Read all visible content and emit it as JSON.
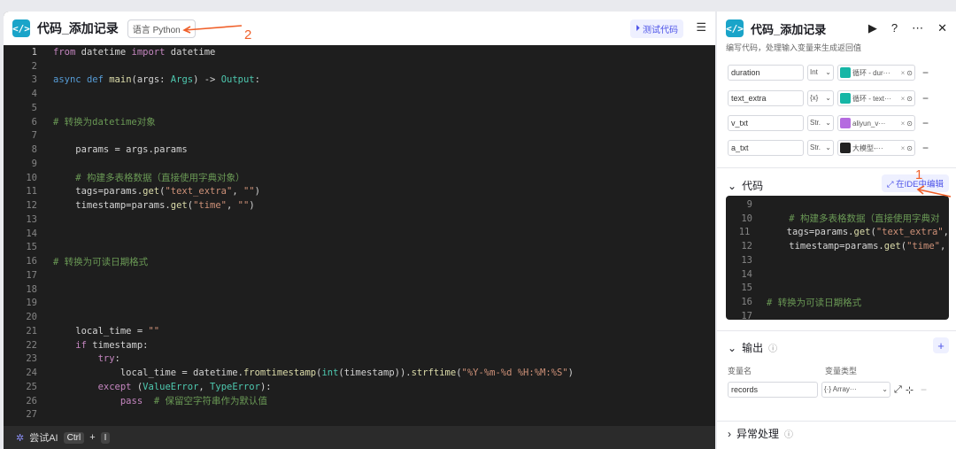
{
  "left_panel": {
    "title": "代码_添加记录",
    "language_select": "语言 Python",
    "test_button": "测试代码",
    "code_lines": [
      {
        "n": "1",
        "t": "from datetime import datetime"
      },
      {
        "n": "2",
        "t": ""
      },
      {
        "n": "3",
        "t": "async def main(args: Args) -> Output:"
      },
      {
        "n": "4",
        "t": ""
      },
      {
        "n": "5",
        "t": ""
      },
      {
        "n": "6",
        "t": "# 转换为datetime对象"
      },
      {
        "n": "7",
        "t": ""
      },
      {
        "n": "8",
        "t": "    params = args.params"
      },
      {
        "n": "9",
        "t": ""
      },
      {
        "n": "10",
        "t": "    # 构建多表格数据（直接使用字典对象）"
      },
      {
        "n": "11",
        "t": "    tags=params.get(\"text_extra\", \"\")"
      },
      {
        "n": "12",
        "t": "    timestamp=params.get(\"time\", \"\")"
      },
      {
        "n": "13",
        "t": ""
      },
      {
        "n": "14",
        "t": ""
      },
      {
        "n": "15",
        "t": ""
      },
      {
        "n": "16",
        "t": "# 转换为可读日期格式"
      },
      {
        "n": "17",
        "t": ""
      },
      {
        "n": "18",
        "t": ""
      },
      {
        "n": "19",
        "t": ""
      },
      {
        "n": "20",
        "t": ""
      },
      {
        "n": "21",
        "t": "    local_time = \"\""
      },
      {
        "n": "22",
        "t": "    if timestamp:"
      },
      {
        "n": "23",
        "t": "        try:"
      },
      {
        "n": "24",
        "t": "            local_time = datetime.fromtimestamp(int(timestamp)).strftime(\"%Y-%m-%d %H:%M:%S\")"
      },
      {
        "n": "25",
        "t": "        except (ValueError, TypeError):"
      },
      {
        "n": "26",
        "t": "            pass  # 保留空字符串作为默认值"
      },
      {
        "n": "27",
        "t": ""
      }
    ],
    "bottom_bar": {
      "label": "尝试AI",
      "key1": "Ctrl",
      "plus": "+",
      "key2": "I"
    }
  },
  "right_panel": {
    "title": "代码_添加记录",
    "description": "编写代码，处理输入变量来生成返回值",
    "input_vars": [
      {
        "name": "duration",
        "type": "Int",
        "ref": "循环 - dur···"
      },
      {
        "name": "text_extra",
        "type": "{x}",
        "ref": "循环 - text···"
      },
      {
        "name": "v_txt",
        "type": "Str.",
        "ref": "aliyun_v···"
      },
      {
        "name": "a_txt",
        "type": "Str.",
        "ref": "大模型-···"
      }
    ],
    "code_section": {
      "label": "代码",
      "ide_button": "在IDE中编辑",
      "preview_lines": [
        {
          "n": "9",
          "t": ""
        },
        {
          "n": "10",
          "t": "    # 构建多表格数据（直接使用字典对"
        },
        {
          "n": "11",
          "t": "    tags=params.get(\"text_extra\","
        },
        {
          "n": "12",
          "t": "    timestamp=params.get(\"time\","
        },
        {
          "n": "13",
          "t": ""
        },
        {
          "n": "14",
          "t": ""
        },
        {
          "n": "15",
          "t": ""
        },
        {
          "n": "16",
          "t": "# 转换为可读日期格式"
        },
        {
          "n": "17",
          "t": ""
        }
      ]
    },
    "output_section": {
      "label": "输出",
      "col_name": "变量名",
      "col_type": "变量类型",
      "var_name": "records",
      "var_type": "{·} Array···"
    },
    "exception_section": {
      "label": "异常处理"
    }
  },
  "annotations": {
    "one": "1",
    "two": "2"
  },
  "colors": {
    "accent": "#4d53e8",
    "brand_teal": "#1aa4c9",
    "annotation": "#f0602a",
    "editor_bg": "#1e1e1e"
  }
}
